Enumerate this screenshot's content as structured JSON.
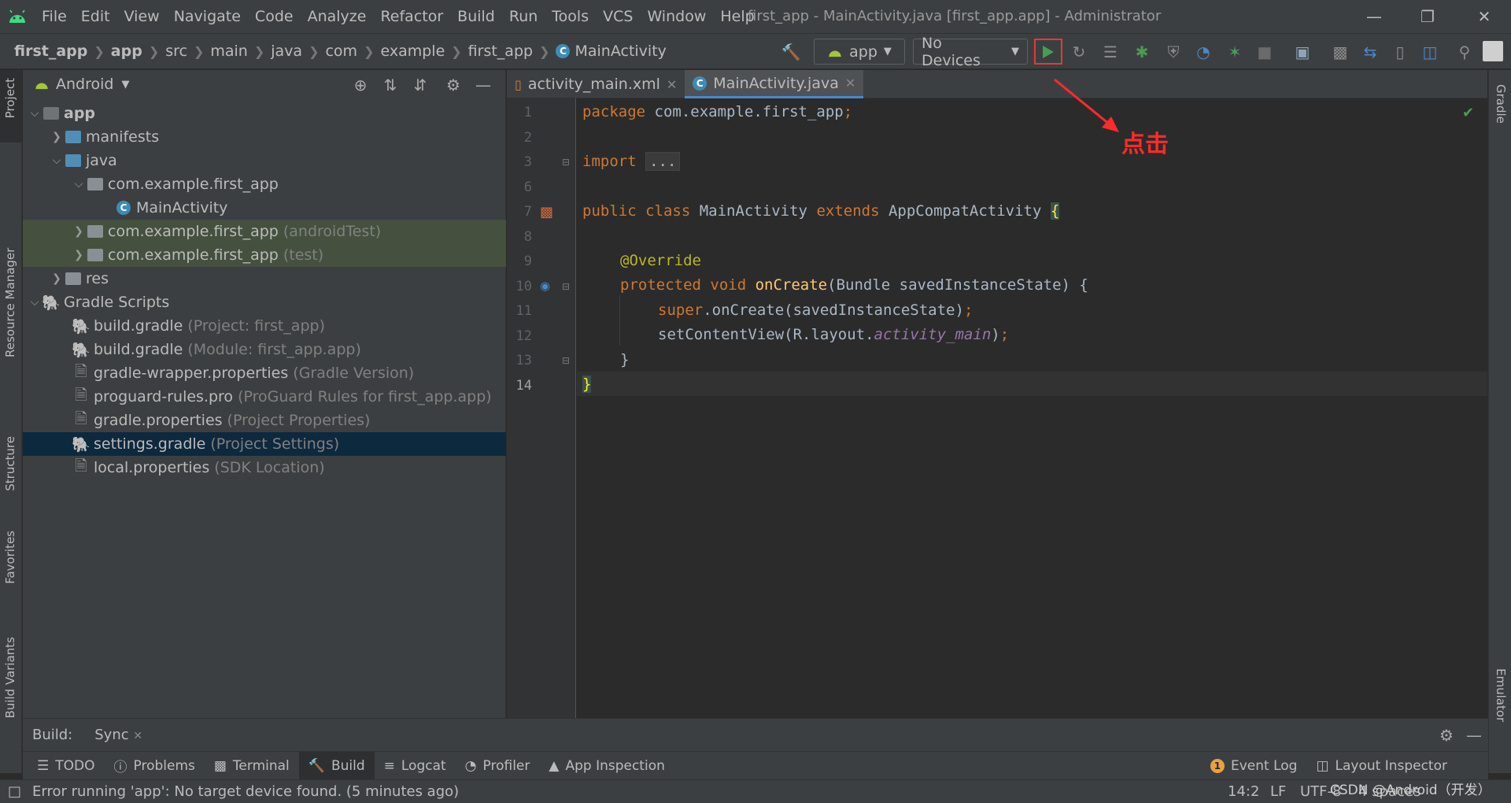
{
  "menu": [
    "File",
    "Edit",
    "View",
    "Navigate",
    "Code",
    "Analyze",
    "Refactor",
    "Build",
    "Run",
    "Tools",
    "VCS",
    "Window",
    "Help"
  ],
  "window_title": "first_app - MainActivity.java [first_app.app] - Administrator",
  "breadcrumb": [
    "first_app",
    "app",
    "src",
    "main",
    "java",
    "com",
    "example",
    "first_app",
    "MainActivity"
  ],
  "toolbar": {
    "run_config": "app",
    "device": "No Devices"
  },
  "project_panel": {
    "view_mode": "Android",
    "tree": [
      {
        "label": "app",
        "hint": ""
      },
      {
        "label": "manifests",
        "hint": ""
      },
      {
        "label": "java",
        "hint": ""
      },
      {
        "label": "com.example.first_app",
        "hint": ""
      },
      {
        "label": "MainActivity",
        "hint": ""
      },
      {
        "label": "com.example.first_app",
        "hint": "(androidTest)"
      },
      {
        "label": "com.example.first_app",
        "hint": "(test)"
      },
      {
        "label": "res",
        "hint": ""
      },
      {
        "label": "Gradle Scripts",
        "hint": ""
      },
      {
        "label": "build.gradle",
        "hint": "(Project: first_app)"
      },
      {
        "label": "build.gradle",
        "hint": "(Module: first_app.app)"
      },
      {
        "label": "gradle-wrapper.properties",
        "hint": "(Gradle Version)"
      },
      {
        "label": "proguard-rules.pro",
        "hint": "(ProGuard Rules for first_app.app)"
      },
      {
        "label": "gradle.properties",
        "hint": "(Project Properties)"
      },
      {
        "label": "settings.gradle",
        "hint": "(Project Settings)"
      },
      {
        "label": "local.properties",
        "hint": "(SDK Location)"
      }
    ]
  },
  "side_tools": {
    "left": [
      "Project",
      "Resource Manager",
      "Structure",
      "Favorites",
      "Build Variants"
    ],
    "right": [
      "Gradle",
      "Emulator"
    ]
  },
  "editor": {
    "tabs": [
      "activity_main.xml",
      "MainActivity.java"
    ],
    "line_numbers": [
      "1",
      "2",
      "3",
      "6",
      "7",
      "8",
      "9",
      "10",
      "11",
      "12",
      "13",
      "14"
    ],
    "code": {
      "package_kw": "package",
      "package_name": " com.example.first_app",
      "import_kw": "import",
      "import_fold": "...",
      "class_kw": "public class",
      "class_name": " MainActivity ",
      "extends_kw": "extends",
      "super_class": " AppCompatActivity ",
      "open_brace": "{",
      "annotation": "@Override",
      "method_kw": "protected void",
      "method_name": "onCreate",
      "method_params": "(Bundle savedInstanceState) {",
      "super_kw": "super",
      "super_call": ".onCreate(savedInstanceState)",
      "set_content": "setContentView(R.layout.",
      "layout_field": "activity_main",
      "close_call": ")",
      "semicolon": ";",
      "close_inner": "}",
      "close_brace": "}"
    }
  },
  "annotation_text": "点击",
  "build_panel": {
    "label": "Build:",
    "tab": "Sync"
  },
  "bottom_tabs": [
    "TODO",
    "Problems",
    "Terminal",
    "Build",
    "Logcat",
    "Profiler",
    "App Inspection"
  ],
  "bottom_right_tabs": [
    "Event Log",
    "Layout Inspector"
  ],
  "event_log_count": "1",
  "status": {
    "message": "Error running 'app': No target device found. (5 minutes ago)",
    "position": "14:2",
    "line_sep": "LF",
    "encoding": "UTF-8",
    "indent": "4 spaces",
    "watermark": "CSDN @Android（开发）"
  },
  "colors": {
    "run_green": "#499c54",
    "highlight_red": "#e03a3a",
    "android_green": "#a4c639"
  }
}
